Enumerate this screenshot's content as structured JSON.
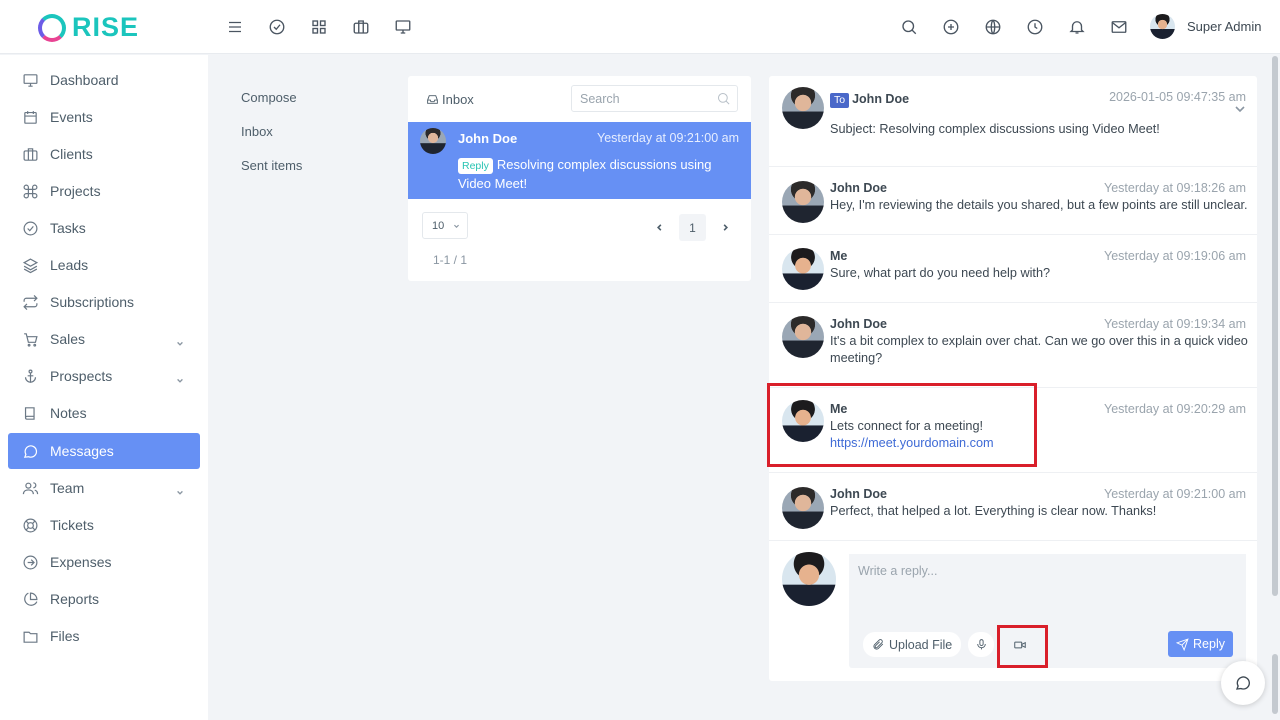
{
  "app": {
    "logo_text": "RISE",
    "brand_color": "#1bc5bd",
    "accent_color": "#6690f4",
    "user_name": "Super Admin"
  },
  "topbar": {
    "left_icons": [
      "menu-icon",
      "check-circle-icon",
      "grid-icon",
      "briefcase-icon",
      "monitor-icon"
    ],
    "right_icons": [
      "search-icon",
      "plus-circle-icon",
      "globe-icon",
      "clock-icon",
      "bell-icon",
      "mail-icon"
    ]
  },
  "sidebar": {
    "items": [
      {
        "label": "Dashboard",
        "icon": "monitor-icon"
      },
      {
        "label": "Events",
        "icon": "calendar-icon"
      },
      {
        "label": "Clients",
        "icon": "briefcase-icon"
      },
      {
        "label": "Projects",
        "icon": "command-icon"
      },
      {
        "label": "Tasks",
        "icon": "check-circle-icon"
      },
      {
        "label": "Leads",
        "icon": "layers-icon"
      },
      {
        "label": "Subscriptions",
        "icon": "repeat-icon"
      },
      {
        "label": "Sales",
        "icon": "cart-icon"
      },
      {
        "label": "Prospects",
        "icon": "anchor-icon"
      },
      {
        "label": "Notes",
        "icon": "book-icon"
      },
      {
        "label": "Messages",
        "icon": "message-circle-icon"
      },
      {
        "label": "Team",
        "icon": "users-icon"
      },
      {
        "label": "Tickets",
        "icon": "life-buoy-icon"
      },
      {
        "label": "Expenses",
        "icon": "arrow-right-circle-icon"
      },
      {
        "label": "Reports",
        "icon": "pie-chart-icon"
      },
      {
        "label": "Files",
        "icon": "folder-icon"
      }
    ],
    "active": "Messages"
  },
  "folders": {
    "compose": "Compose",
    "inbox": "Inbox",
    "sent": "Sent items"
  },
  "inbox": {
    "title": "Inbox",
    "search_placeholder": "Search",
    "row": {
      "name": "John Doe",
      "time": "Yesterday at 09:21:00 am",
      "badge": "Reply",
      "subject": "Resolving complex discussions using Video Meet!"
    },
    "page_size": "10",
    "current_page": "1",
    "range": "1-1 / 1"
  },
  "conversation": {
    "header": {
      "to_badge": "To",
      "name": "John Doe",
      "time": "2026-01-05 09:47:35 am",
      "subject": "Subject: Resolving complex discussions using Video Meet!"
    },
    "messages": [
      {
        "name": "John Doe",
        "time": "Yesterday at 09:18:26 am",
        "text": "Hey, I'm reviewing the details you shared, but a few points are still unclear."
      },
      {
        "name": "Me",
        "time": "Yesterday at 09:19:06 am",
        "text": "Sure, what part do you need help with?"
      },
      {
        "name": "John Doe",
        "time": "Yesterday at 09:19:34 am",
        "text": "It's a bit complex to explain over chat. Can we go over this in a quick video meeting?"
      },
      {
        "name": "Me",
        "time": "Yesterday at 09:20:29 am",
        "text": "Lets connect for a meeting!",
        "link": "https://meet.yourdomain.com"
      },
      {
        "name": "John Doe",
        "time": "Yesterday at 09:21:00 am",
        "text": "Perfect, that helped a lot. Everything is clear now. Thanks!"
      }
    ],
    "reply_placeholder": "Write a reply...",
    "upload_label": "Upload File",
    "send_label": "Reply"
  },
  "highlight_color": "#d91f2a"
}
